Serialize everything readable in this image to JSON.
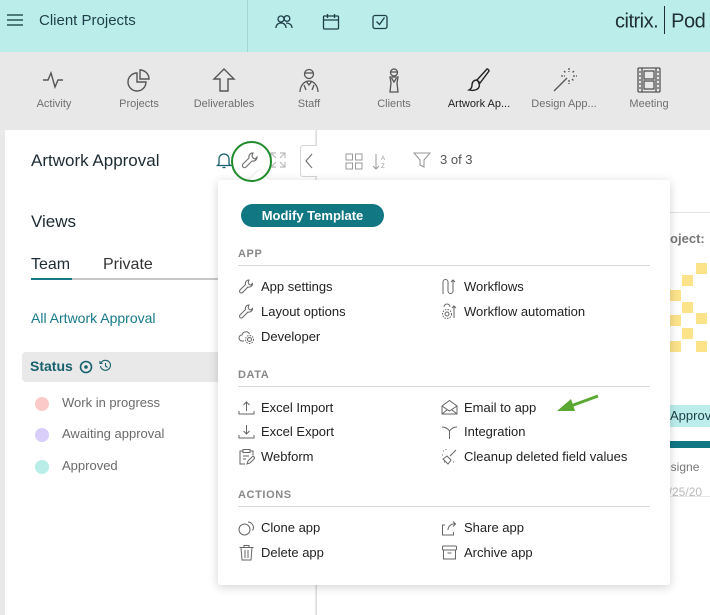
{
  "header": {
    "app_title": "Client Projects",
    "icons": [
      "people-icon",
      "calendar-icon",
      "checkbox-icon"
    ],
    "brand": "citrix.",
    "product": "Pod"
  },
  "apps": [
    {
      "label": "Activity",
      "icon": "activity-icon",
      "active": false
    },
    {
      "label": "Projects",
      "icon": "pie-chart-icon",
      "active": false
    },
    {
      "label": "Deliverables",
      "icon": "upload-arrow-icon",
      "active": false
    },
    {
      "label": "Staff",
      "icon": "staff-icon",
      "active": false
    },
    {
      "label": "Clients",
      "icon": "client-icon",
      "active": false
    },
    {
      "label": "Artwork Ap...",
      "icon": "paintbrush-icon",
      "active": true
    },
    {
      "label": "Design App...",
      "icon": "magic-wand-icon",
      "active": false
    },
    {
      "label": "Meeting",
      "icon": "film-icon",
      "active": false
    }
  ],
  "sidebar": {
    "title": "Artwork Approval",
    "views_heading": "Views",
    "tabs": [
      {
        "label": "Team",
        "active": true
      },
      {
        "label": "Private",
        "active": false
      }
    ],
    "current_view": "All Artwork Approval",
    "status_heading": "Status",
    "statuses": [
      {
        "label": "Work in progress",
        "color": "#fcc9c9"
      },
      {
        "label": "Awaiting approval",
        "color": "#d9cdfa"
      },
      {
        "label": "Approved",
        "color": "#b8ede8"
      }
    ]
  },
  "toolbar": {
    "record_count": "3 of 3"
  },
  "card": {
    "project_label": "roject:",
    "status_badge": "Approv",
    "designer": "esigne",
    "date": "5/25/20"
  },
  "menu": {
    "modify_template": "Modify Template",
    "sections": {
      "app": {
        "heading": "APP",
        "left": [
          {
            "label": "App settings",
            "icon": "wrench-icon"
          },
          {
            "label": "Layout options",
            "icon": "wrench-icon"
          },
          {
            "label": "Developer",
            "icon": "cloud-gear-icon"
          }
        ],
        "right": [
          {
            "label": "Workflows",
            "icon": "workflow-icon"
          },
          {
            "label": "Workflow automation",
            "icon": "gear-workflow-icon"
          }
        ]
      },
      "data": {
        "heading": "DATA",
        "left": [
          {
            "label": "Excel Import",
            "icon": "import-icon"
          },
          {
            "label": "Excel Export",
            "icon": "export-icon"
          },
          {
            "label": "Webform",
            "icon": "clipboard-edit-icon"
          }
        ],
        "right": [
          {
            "label": "Email to app",
            "icon": "open-envelope-icon"
          },
          {
            "label": "Integration",
            "icon": "integration-icon"
          },
          {
            "label": "Cleanup deleted field values",
            "icon": "broom-icon"
          }
        ]
      },
      "actions": {
        "heading": "ACTIONS",
        "left": [
          {
            "label": "Clone app",
            "icon": "clone-icon"
          },
          {
            "label": "Delete app",
            "icon": "trash-icon"
          }
        ],
        "right": [
          {
            "label": "Share app",
            "icon": "share-icon"
          },
          {
            "label": "Archive app",
            "icon": "archive-icon"
          }
        ]
      }
    }
  },
  "colors": {
    "header_bg": "#bbeeeb",
    "accent": "#117783",
    "annotation_green": "#1f8b2b",
    "arrow_green": "#5aa832"
  }
}
